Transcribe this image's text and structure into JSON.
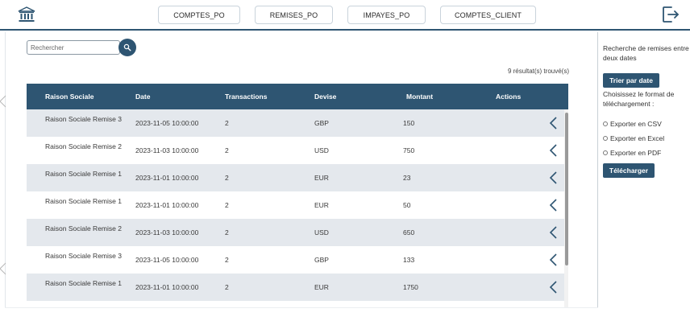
{
  "nav": {
    "logo_icon": "bank-icon",
    "tabs": [
      {
        "label": "COMPTES_PO"
      },
      {
        "label": "REMISES_PO"
      },
      {
        "label": "IMPAYES_PO"
      },
      {
        "label": "COMPTES_CLIENT"
      }
    ],
    "logout_icon": "logout-icon"
  },
  "search": {
    "placeholder": "Rechercher",
    "button_icon": "search-icon"
  },
  "results_count": "9 résultat(s) trouvé(s)",
  "table": {
    "headers": [
      "Raison Sociale",
      "Date",
      "Transactions",
      "Devise",
      "Montant",
      "Actions"
    ],
    "rows": [
      {
        "raison": "Raison Sociale Remise 3",
        "date": "2023-11-05 10:00:00",
        "transactions": "2",
        "devise": "GBP",
        "montant": "150"
      },
      {
        "raison": "Raison Sociale Remise 2",
        "date": "2023-11-03 10:00:00",
        "transactions": "2",
        "devise": "USD",
        "montant": "750"
      },
      {
        "raison": "Raison Sociale Remise 1",
        "date": "2023-11-01 10:00:00",
        "transactions": "2",
        "devise": "EUR",
        "montant": "23"
      },
      {
        "raison": "Raison Sociale Remise 1",
        "date": "2023-11-01 10:00:00",
        "transactions": "2",
        "devise": "EUR",
        "montant": "50"
      },
      {
        "raison": "Raison Sociale Remise 2",
        "date": "2023-11-03 10:00:00",
        "transactions": "2",
        "devise": "USD",
        "montant": "650"
      },
      {
        "raison": "Raison Sociale Remise 3",
        "date": "2023-11-05 10:00:00",
        "transactions": "2",
        "devise": "GBP",
        "montant": "133"
      },
      {
        "raison": "Raison Sociale Remise 1",
        "date": "2023-11-01 10:00:00",
        "transactions": "2",
        "devise": "EUR",
        "montant": "1750"
      }
    ],
    "action_icon": "chevron-left-icon"
  },
  "side": {
    "intro": [
      "Recherche de remises entre",
      "deux dates"
    ],
    "sort_button": "Trier par date",
    "format_label": [
      "Choisissez le format de",
      "téléchargement :"
    ],
    "options": [
      "Exporter en CSV",
      "Exporter en Excel",
      "Exporter en PDF"
    ],
    "download_button": "Télécharger"
  },
  "colors": {
    "primary": "#2e5572",
    "row_alt": "#e4e8ed"
  }
}
